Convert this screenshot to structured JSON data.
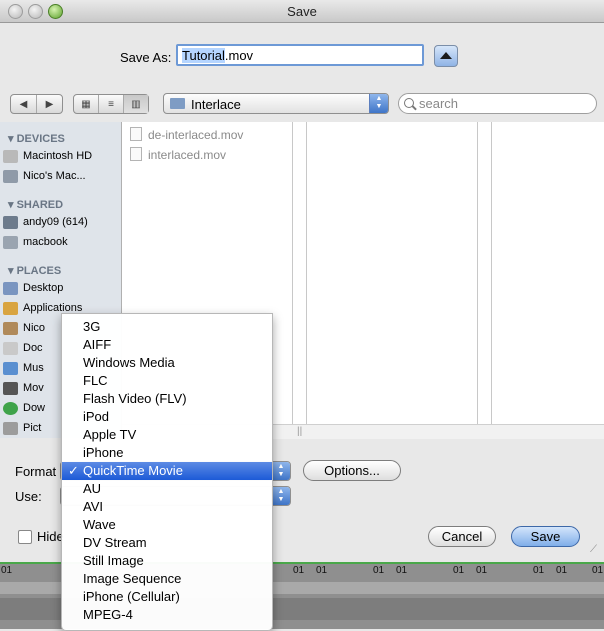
{
  "window": {
    "title": "Save"
  },
  "save_as": {
    "label": "Save As:",
    "filename_selected": "Tutorial",
    "filename_ext": ".mov"
  },
  "toolbar": {
    "location": "Interlace",
    "search_placeholder": "search"
  },
  "sidebar": {
    "devices_heading": "DEVICES",
    "devices": [
      "Macintosh HD",
      "Nico's Mac..."
    ],
    "shared_heading": "SHARED",
    "shared": [
      "andy09 (614)",
      "macbook"
    ],
    "places_heading": "PLACES",
    "places": [
      "Desktop",
      "Applications",
      "Nico",
      "Doc",
      "Mus",
      "Mov",
      "Dow",
      "Pict"
    ]
  },
  "files": [
    "de-interlaced.mov",
    "interlaced.mov"
  ],
  "options": {
    "format_label": "Format",
    "use_label": "Use:",
    "options_button": "Options...",
    "hide_extension": "Hide",
    "cancel_button": "Cancel",
    "save_button": "Save"
  },
  "format_menu": {
    "items": [
      "3G",
      "AIFF",
      "Windows Media",
      "FLC",
      "Flash Video (FLV)",
      "iPod",
      "Apple TV",
      "iPhone",
      "QuickTime Movie",
      "AU",
      "AVI",
      "Wave",
      "DV Stream",
      "Still Image",
      "Image Sequence",
      "iPhone (Cellular)",
      "MPEG-4"
    ],
    "selected": "QuickTime Movie",
    "check": "✓"
  },
  "timeline": {
    "tick": "01"
  },
  "colors": {
    "accent": "#1c5ad7",
    "sidebar": "#dfe4ea",
    "window": "#e8e8e8"
  }
}
